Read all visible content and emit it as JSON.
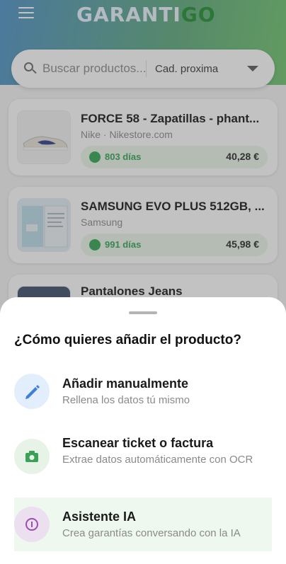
{
  "app": {
    "logo_left": "GARANTI",
    "logo_right": "GO"
  },
  "search": {
    "placeholder": "Buscar productos...",
    "sort_value": "Cad. proxima"
  },
  "products": [
    {
      "title": "FORCE 58 - Zapatillas - phant...",
      "subtitle": "Nike · Nikestore.com",
      "days": "803 días",
      "price": "40,28 €"
    },
    {
      "title": "SAMSUNG EVO PLUS 512GB, ...",
      "subtitle": "Samsung",
      "days": "991 días",
      "price": "45,98 €"
    },
    {
      "title": "Pantalones Jeans"
    }
  ],
  "sheet": {
    "title": "¿Cómo quieres añadir el producto?",
    "options": [
      {
        "title": "Añadir manualmente",
        "description": "Rellena los datos tú mismo",
        "icon": "pencil-icon"
      },
      {
        "title": "Escanear ticket o factura",
        "description": "Extrae datos automáticamente con OCR",
        "icon": "camera-icon"
      },
      {
        "title": "Asistente IA",
        "description": "Crea garantías conversando con la IA",
        "icon": "info-icon"
      }
    ]
  },
  "colors": {
    "accent_green": "#2ea44f",
    "brand_blue": "#4a90c7"
  }
}
